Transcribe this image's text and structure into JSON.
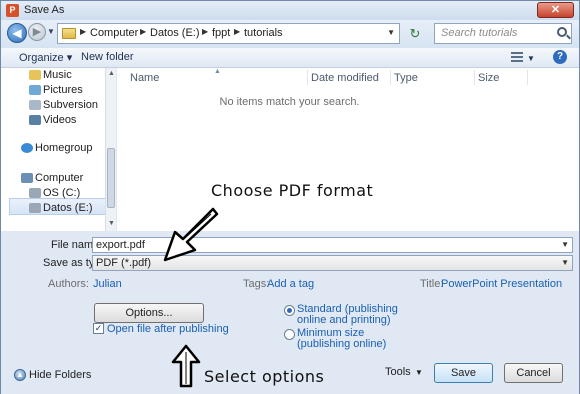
{
  "window": {
    "title": "Save As",
    "app_icon": "P",
    "close_label": "✕"
  },
  "address": {
    "crumbs": [
      "Computer",
      "Datos (E:)",
      "fppt",
      "tutorials"
    ],
    "search_placeholder": "Search tutorials"
  },
  "toolbar": {
    "organize_label": "Organize ▾",
    "new_folder_label": "New folder"
  },
  "nav": {
    "items": [
      {
        "label": "Music",
        "icon": "music-icon"
      },
      {
        "label": "Pictures",
        "icon": "pictures-icon"
      },
      {
        "label": "Subversion",
        "icon": "subversion-icon"
      },
      {
        "label": "Videos",
        "icon": "videos-icon"
      },
      {
        "label": "Homegroup",
        "icon": "homegroup-icon"
      },
      {
        "label": "Computer",
        "icon": "computer-icon"
      },
      {
        "label": "OS (C:)",
        "icon": "drive-icon"
      },
      {
        "label": "Datos (E:)",
        "icon": "drive-icon",
        "selected": true
      }
    ]
  },
  "files": {
    "columns": [
      "Name",
      "Date modified",
      "Type",
      "Size"
    ],
    "empty_message": "No items match your search."
  },
  "form": {
    "file_name_label": "File name:",
    "file_name_value": "export.pdf",
    "save_type_label": "Save as type:",
    "save_type_value": "PDF (*.pdf)",
    "authors_label": "Authors:",
    "authors_value": "Julian",
    "tags_label": "Tags:",
    "tags_value": "Add a tag",
    "title_label": "Title:",
    "title_value": "PowerPoint Presentation",
    "options_button": "Options...",
    "open_after_label": "Open file after publishing",
    "open_after_checked": true,
    "optimize": {
      "standard_line1": "Standard (publishing",
      "standard_line2": "online and printing)",
      "minimum_line1": "Minimum size",
      "minimum_line2": "(publishing online)",
      "selected": "standard"
    }
  },
  "footer": {
    "hide_folders": "Hide Folders",
    "tools": "Tools",
    "save": "Save",
    "cancel": "Cancel"
  },
  "annotations": {
    "choose_pdf": "Choose PDF format",
    "select_options": "Select options"
  }
}
